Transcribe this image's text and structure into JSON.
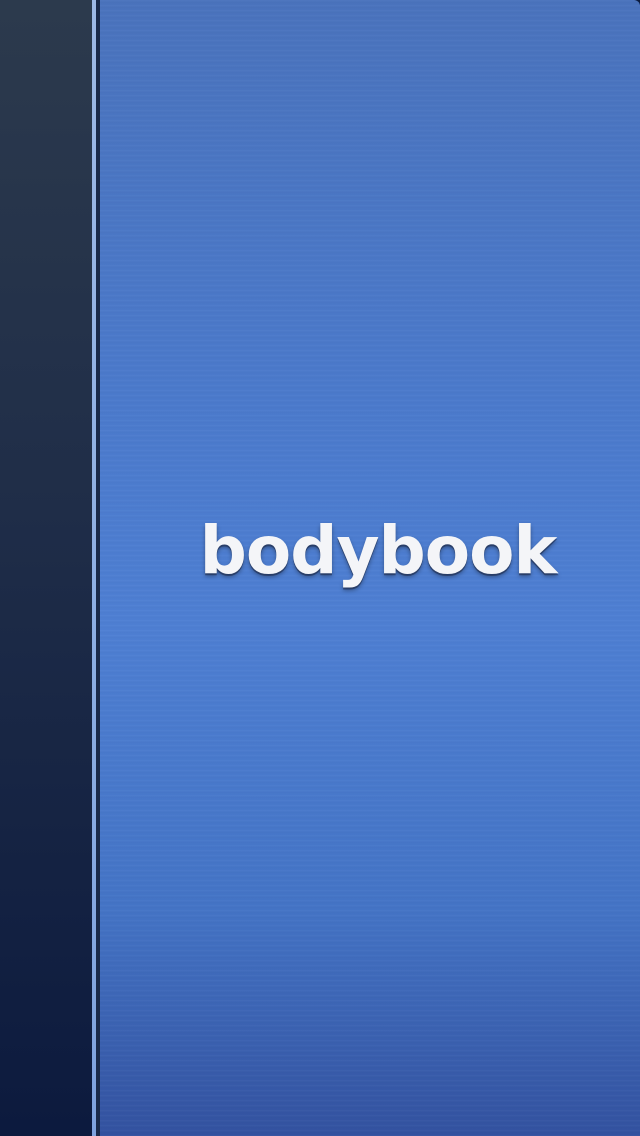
{
  "app": {
    "logo_text": "bodybook"
  },
  "colors": {
    "spine_top": "#2c3a4d",
    "spine_bottom": "#0c1a3e",
    "spine_edge": "#9db9e6",
    "cover_blue": "#4e7fd3",
    "logo_text": "#f4f5f8"
  }
}
